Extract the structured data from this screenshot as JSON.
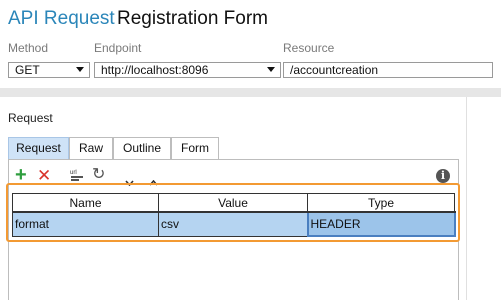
{
  "header": {
    "app_title": "API Request",
    "page_title": "Registration Form"
  },
  "fields": {
    "method": {
      "label": "Method",
      "value": "GET"
    },
    "endpoint": {
      "label": "Endpoint",
      "value": "http://localhost:8096"
    },
    "resource": {
      "label": "Resource",
      "value": "/accountcreation"
    }
  },
  "request": {
    "section_label": "Request",
    "tabs": [
      {
        "label": "Request",
        "active": true
      },
      {
        "label": "Raw",
        "active": false
      },
      {
        "label": "Outline",
        "active": false
      },
      {
        "label": "Form",
        "active": false
      }
    ],
    "toolbar": {
      "add_icon": "plus-icon",
      "remove_icon": "delete-x-icon",
      "url_icon": "url-param-icon",
      "refresh_icon": "refresh-icon",
      "down_icon": "chevron-down-icon",
      "up_icon": "chevron-up-icon",
      "info_icon": "info-icon"
    },
    "table": {
      "columns": [
        "Name",
        "Value",
        "Type"
      ],
      "rows": [
        {
          "name": "format",
          "value": "csv",
          "type": "HEADER"
        }
      ]
    }
  },
  "colors": {
    "title_accent": "#2b86b9",
    "highlight_border": "#f39a33",
    "row_selected": "#b5d4f1",
    "add_green": "#2e9e3e",
    "remove_red": "#d9342b"
  }
}
